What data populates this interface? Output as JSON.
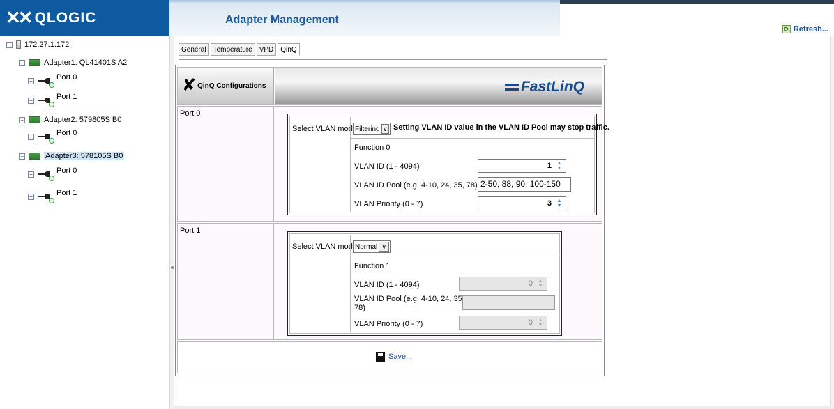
{
  "brand": {
    "name": "QLOGIC"
  },
  "header": {
    "title": "Adapter Management",
    "refresh_label": "Refresh..."
  },
  "tree": {
    "server": "172.27.1.172",
    "adapters": [
      {
        "label": "Adapter1: QL41401S A2",
        "ports": [
          "Port 0",
          "Port 1"
        ]
      },
      {
        "label": "Adapter2: 579805S B0",
        "ports": [
          "Port 0"
        ]
      },
      {
        "label": "Adapter3: 578105S B0",
        "ports": [
          "Port 0",
          "Port 1"
        ],
        "selected": true
      }
    ]
  },
  "tabs": [
    "General",
    "Temperature",
    "VPD",
    "QinQ"
  ],
  "active_tab": "QinQ",
  "panel": {
    "section_title": "QinQ Configurations",
    "brand_logo": "FastLinQ",
    "ports": [
      {
        "label": "Port 0",
        "mode_label": "Select VLAN mode:",
        "mode_value": "Filtering",
        "warning": "Setting VLAN ID value in the VLAN ID Pool may stop traffic.",
        "function_label": "Function 0",
        "vlan_id_label": "VLAN ID (1 - 4094)",
        "vlan_id_value": "1",
        "pool_label": "VLAN ID Pool (e.g. 4-10, 24, 35, 78)",
        "pool_value": "2-50, 88, 90, 100-150",
        "priority_label": "VLAN Priority (0 - 7)",
        "priority_value": "3"
      },
      {
        "label": "Port 1",
        "mode_label": "Select VLAN mode:",
        "mode_value": "Normal",
        "function_label": "Function 1",
        "vlan_id_label": "VLAN ID (1 - 4094)",
        "vlan_id_value": "0",
        "pool_label_line1": "VLAN ID Pool (e.g. 4-10, 24, 35,",
        "pool_label_line2": "78)",
        "pool_value": "",
        "priority_label": "VLAN Priority (0 - 7)",
        "priority_value": "0"
      }
    ],
    "save_label": "Save..."
  },
  "colors": {
    "brand_blue": "#0e5aa1",
    "title_blue": "#1d5a97",
    "link_blue": "#1a4fa0"
  }
}
